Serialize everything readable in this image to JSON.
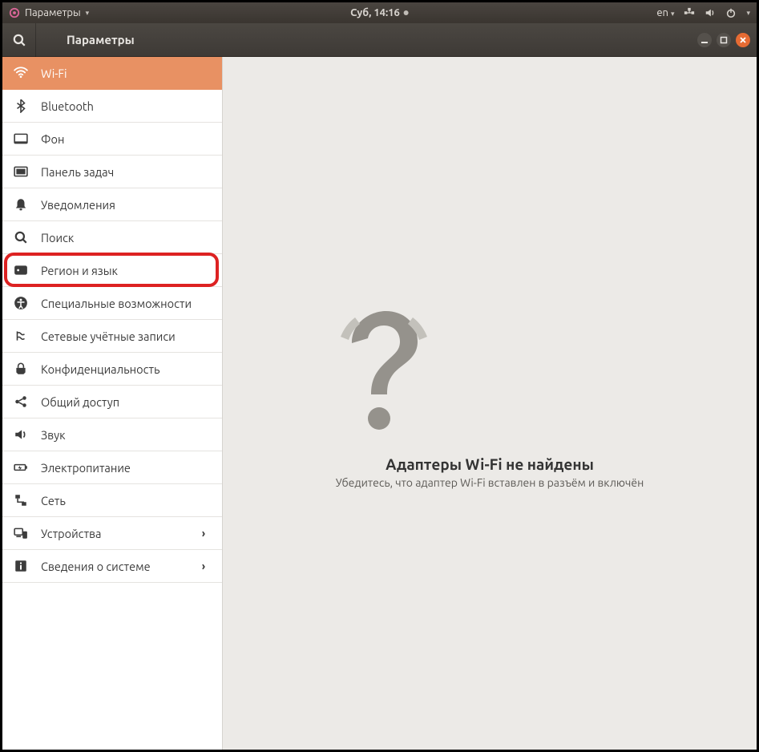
{
  "topbar": {
    "app_menu": "Параметры",
    "clock": "Суб, 14:16",
    "lang": "en"
  },
  "header": {
    "title": "Параметры"
  },
  "sidebar": {
    "items": [
      {
        "id": "wifi",
        "label": "Wi-Fi",
        "active": true,
        "arrow": false
      },
      {
        "id": "bluetooth",
        "label": "Bluetooth",
        "active": false,
        "arrow": false
      },
      {
        "id": "background",
        "label": "Фон",
        "active": false,
        "arrow": false
      },
      {
        "id": "dock",
        "label": "Панель задач",
        "active": false,
        "arrow": false
      },
      {
        "id": "notifications",
        "label": "Уведомления",
        "active": false,
        "arrow": false
      },
      {
        "id": "search",
        "label": "Поиск",
        "active": false,
        "arrow": false
      },
      {
        "id": "region",
        "label": "Регион и язык",
        "active": false,
        "arrow": false,
        "highlighted": true
      },
      {
        "id": "accessibility",
        "label": "Специальные возможности",
        "active": false,
        "arrow": false
      },
      {
        "id": "online-accounts",
        "label": "Сетевые учётные записи",
        "active": false,
        "arrow": false
      },
      {
        "id": "privacy",
        "label": "Конфиденциальность",
        "active": false,
        "arrow": false
      },
      {
        "id": "sharing",
        "label": "Общий доступ",
        "active": false,
        "arrow": false
      },
      {
        "id": "sound",
        "label": "Звук",
        "active": false,
        "arrow": false
      },
      {
        "id": "power",
        "label": "Электропитание",
        "active": false,
        "arrow": false
      },
      {
        "id": "network",
        "label": "Сеть",
        "active": false,
        "arrow": false
      },
      {
        "id": "devices",
        "label": "Устройства",
        "active": false,
        "arrow": true
      },
      {
        "id": "about",
        "label": "Сведения о системе",
        "active": false,
        "arrow": true
      }
    ]
  },
  "content": {
    "empty_title": "Адаптеры Wi-Fi не найдены",
    "empty_subtitle": "Убедитесь, что адаптер Wi-Fi вставлен в разъём и включён"
  }
}
